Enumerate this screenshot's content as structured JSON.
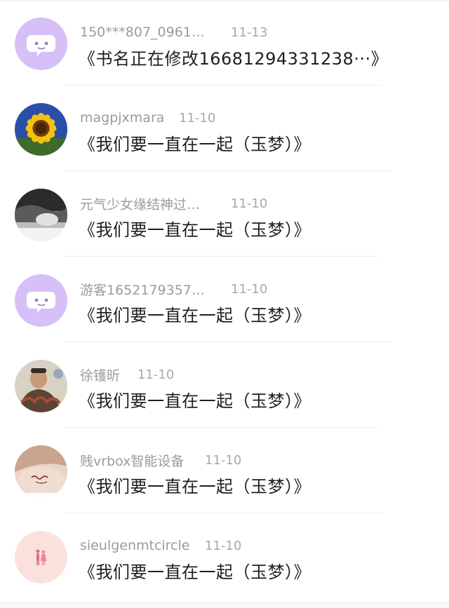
{
  "comments": [
    {
      "username": "150***807_0961…",
      "date": "11-13",
      "title": "《书名正在修改16681294331238···》",
      "avatar": "default-chat-avatar"
    },
    {
      "username": "magpjxmara",
      "date": "11-10",
      "title": "《我们要一直在一起（玉梦）》",
      "avatar": "sunflower-avatar"
    },
    {
      "username": "元气少女缘结神过…",
      "date": "11-10",
      "title": "《我们要一直在一起（玉梦）》",
      "avatar": "bw-photo-avatar"
    },
    {
      "username": "游客1652179357…",
      "date": "11-10",
      "title": "《我们要一直在一起（玉梦）》",
      "avatar": "default-chat-avatar"
    },
    {
      "username": "徐镬昕",
      "date": "11-10",
      "title": "《我们要一直在一起（玉梦）》",
      "avatar": "person-photo-avatar"
    },
    {
      "username": "贱vrbox智能设备",
      "date": "11-10",
      "title": "《我们要一直在一起（玉梦）》",
      "avatar": "tattoo-photo-avatar"
    },
    {
      "username": "sieulgenmtcircle",
      "date": "11-10",
      "title": "《我们要一直在一起（玉梦）》",
      "avatar": "pink-couple-avatar"
    }
  ],
  "colors": {
    "default_avatar_bg": "#d7bff7",
    "username": "#9b9b9b",
    "date": "#a8a8a8",
    "title": "#1f1f1f",
    "divider": "#eeeeee"
  }
}
